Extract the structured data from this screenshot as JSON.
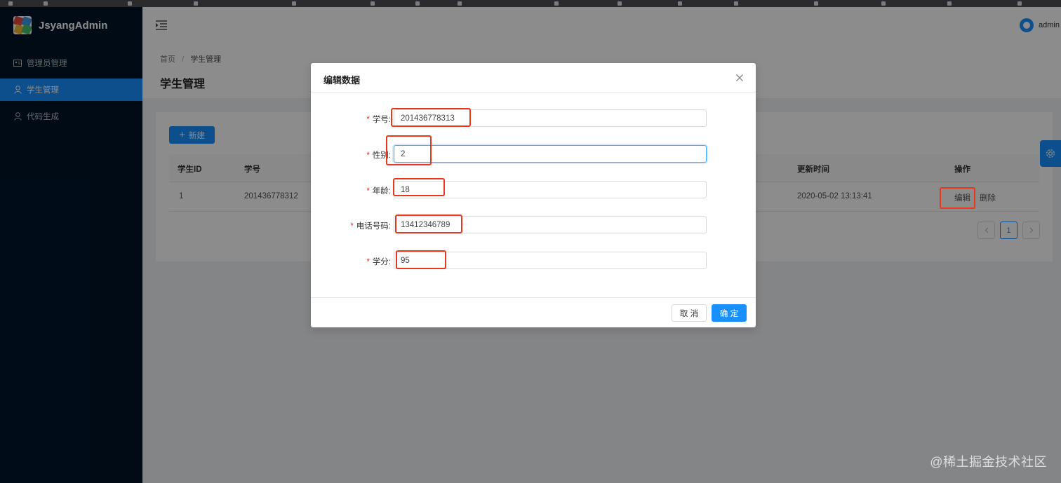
{
  "app": {
    "name": "JsyangAdmin"
  },
  "sidebar": {
    "items": [
      {
        "label": "管理员管理",
        "icon": "id-card-icon",
        "active": false
      },
      {
        "label": "学生管理",
        "icon": "user-icon",
        "active": true
      },
      {
        "label": "代码生成",
        "icon": "user-icon",
        "active": false
      }
    ]
  },
  "header": {
    "username": "admin"
  },
  "breadcrumb": {
    "home": "首页",
    "separator": "/",
    "current": "学生管理"
  },
  "page": {
    "title": "学生管理"
  },
  "toolbar": {
    "new_label": "新建"
  },
  "table": {
    "headers": {
      "id": "学生ID",
      "number": "学号",
      "updated": "更新时间",
      "actions": "操作"
    },
    "rows": [
      {
        "id": "1",
        "number": "201436778312",
        "updated": "2020-05-02 13:13:41",
        "edit": "编辑",
        "delete": "删除"
      }
    ]
  },
  "pagination": {
    "current": "1"
  },
  "modal": {
    "title": "编辑数据",
    "fields": [
      {
        "label": "学号",
        "value": "201436778313"
      },
      {
        "label": "性别",
        "value": "2"
      },
      {
        "label": "年龄",
        "value": "18"
      },
      {
        "label": "电话号码",
        "value": "13412346789"
      },
      {
        "label": "学分",
        "value": "95"
      }
    ],
    "cancel_label": "取 消",
    "ok_label": "确 定"
  },
  "watermark": "@稀土掘金技术社区",
  "colors": {
    "primary": "#1890ff",
    "sidebar": "#001529",
    "annotation": "#e8371c",
    "required": "#f5222d"
  }
}
